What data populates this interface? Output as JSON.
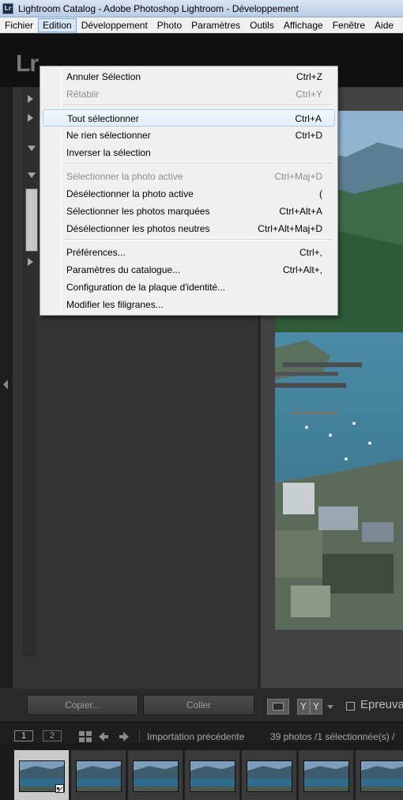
{
  "window": {
    "title": "Lightroom Catalog - Adobe Photoshop Lightroom - Développement",
    "icon": "Lr"
  },
  "menubar": [
    {
      "label": "Fichier"
    },
    {
      "label": "Edition",
      "active": true
    },
    {
      "label": "Développement"
    },
    {
      "label": "Photo"
    },
    {
      "label": "Paramètres"
    },
    {
      "label": "Outils"
    },
    {
      "label": "Affichage"
    },
    {
      "label": "Fenêtre"
    },
    {
      "label": "Aide"
    }
  ],
  "edit_menu": {
    "items": [
      {
        "label": "Annuler Sélection",
        "shortcut": "Ctrl+Z",
        "disabled": false
      },
      {
        "label": "Rétablir",
        "shortcut": "Ctrl+Y",
        "disabled": true
      },
      {
        "label": "Tout sélectionner",
        "shortcut": "Ctrl+A",
        "disabled": false,
        "highlighted": true
      },
      {
        "label": "Ne rien sélectionner",
        "shortcut": "Ctrl+D",
        "disabled": false
      },
      {
        "label": "Inverser la sélection",
        "shortcut": "",
        "disabled": false
      },
      {
        "label": "Sélectionner la photo active",
        "shortcut": "Ctrl+Maj+D",
        "disabled": true
      },
      {
        "label": "Désélectionner la photo active",
        "shortcut": "(",
        "disabled": false
      },
      {
        "label": "Sélectionner les photos marquées",
        "shortcut": "Ctrl+Alt+A",
        "disabled": false
      },
      {
        "label": "Désélectionner les photos neutres",
        "shortcut": "Ctrl+Alt+Maj+D",
        "disabled": false
      },
      {
        "label": "Préférences...",
        "shortcut": "Ctrl+,",
        "disabled": false
      },
      {
        "label": "Paramètres du catalogue...",
        "shortcut": "Ctrl+Alt+,",
        "disabled": false
      },
      {
        "label": "Configuration de la plaque d'identité...",
        "shortcut": "",
        "disabled": false
      },
      {
        "label": "Modifier les filigranes...",
        "shortcut": "",
        "disabled": false
      }
    ]
  },
  "identity_plate": {
    "logo_text": "Lr"
  },
  "left_panel": {
    "copy_button": "Copier...",
    "paste_button": "Coller"
  },
  "toolbar": {
    "ratings_label": "Y",
    "proof_label": "Epreuva"
  },
  "filmstrip_header": {
    "view_1": "1",
    "view_2": "2",
    "source": "Importation précédente",
    "count": "39 photos /1 sélectionnée(s) /"
  },
  "filmstrip": {
    "visible_thumbnails": 7,
    "selected_index": 0
  },
  "colors": {
    "menu_highlight_border": "#aecbef",
    "app_bg": "#2b2b2b",
    "accent_active_menu": "#d7e6f7"
  }
}
